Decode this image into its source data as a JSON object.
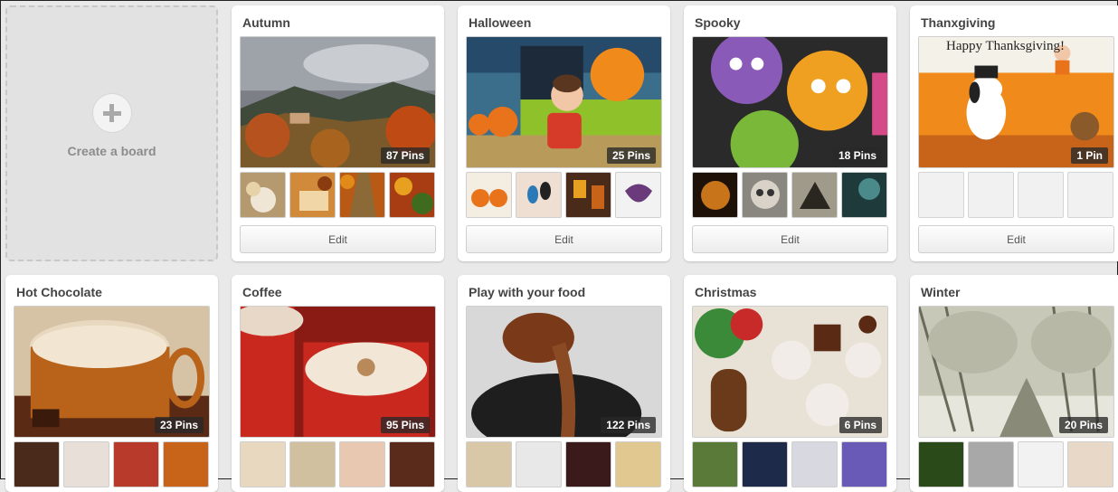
{
  "create_board": {
    "label": "Create a board",
    "icon": "plus-icon"
  },
  "boards": [
    {
      "title": "Autumn",
      "pins": "87 Pins",
      "edit": "Edit"
    },
    {
      "title": "Halloween",
      "pins": "25 Pins",
      "edit": "Edit"
    },
    {
      "title": "Spooky",
      "pins": "18 Pins",
      "edit": "Edit"
    },
    {
      "title": "Thanxgiving",
      "pins": "1 Pin",
      "edit": "Edit",
      "cover_caption": "Happy Thanksgiving!"
    },
    {
      "title": "Hot Chocolate",
      "pins": "23 Pins"
    },
    {
      "title": "Coffee",
      "pins": "95 Pins"
    },
    {
      "title": "Play with your food",
      "pins": "122 Pins"
    },
    {
      "title": "Christmas",
      "pins": "6 Pins"
    },
    {
      "title": "Winter",
      "pins": "20 Pins"
    }
  ]
}
